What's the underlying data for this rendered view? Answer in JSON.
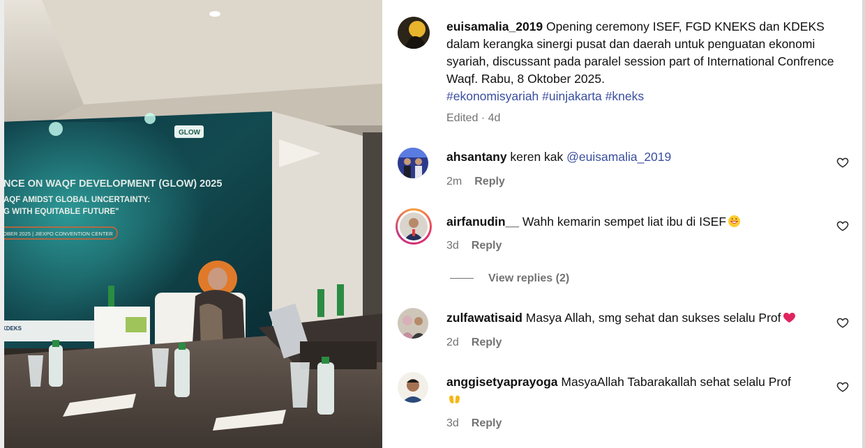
{
  "post": {
    "username": "euisamalia_2019",
    "caption": " Opening ceremony ISEF, FGD KNEKS dan KDEKS dalam kerangka sinergi pusat dan daerah untuk penguatan ekonomi syariah, discussant pada paralel session part of International Confrence Waqf. Rabu, 8 Oktober 2025.",
    "hashtags": [
      "#ekonomisyariah",
      "#uinjakarta",
      "#kneks"
    ],
    "edited": "Edited · 4d"
  },
  "banner": {
    "line1": "NCE ON WAQF DEVELOPMENT (GLOW) 2025",
    "line2": "AQF AMIDST GLOBAL UNCERTAINTY:",
    "line3": "G WITH EQUITABLE FUTURE\"",
    "date": "OBER 2025 | JIEXPO CONVENTION CENTER",
    "logo": "GLOW",
    "sponsor": "KDEKS"
  },
  "comments": [
    {
      "username": "ahsantany",
      "text": " keren kak ",
      "mention": "@euisamalia_2019",
      "time": "2m",
      "reply": "Reply"
    },
    {
      "username": "airfanudin__",
      "text": " Wahh kemarin sempet liat ibu di ISEF",
      "time": "3d",
      "reply": "Reply",
      "view_replies": "View replies (2)"
    },
    {
      "username": "zulfawatisaid",
      "text": " Masya Allah, smg sehat dan sukses selalu Prof",
      "time": "2d",
      "reply": "Reply"
    },
    {
      "username": "anggisetyaprayoga",
      "text": " MasyaAllah Tabarakallah sehat selalu Prof",
      "time": "3d",
      "reply": "Reply"
    }
  ],
  "icons": {
    "like": "heart-outline-icon",
    "emoji_grin": "grinning-face-emoji",
    "emoji_heart": "red-heart-emoji",
    "emoji_hands": "open-hands-emoji"
  },
  "colors": {
    "link": "#3a4ea0",
    "muted": "#737373",
    "heart_emoji": "#e0245e",
    "hands_emoji": "#f5b71a"
  }
}
